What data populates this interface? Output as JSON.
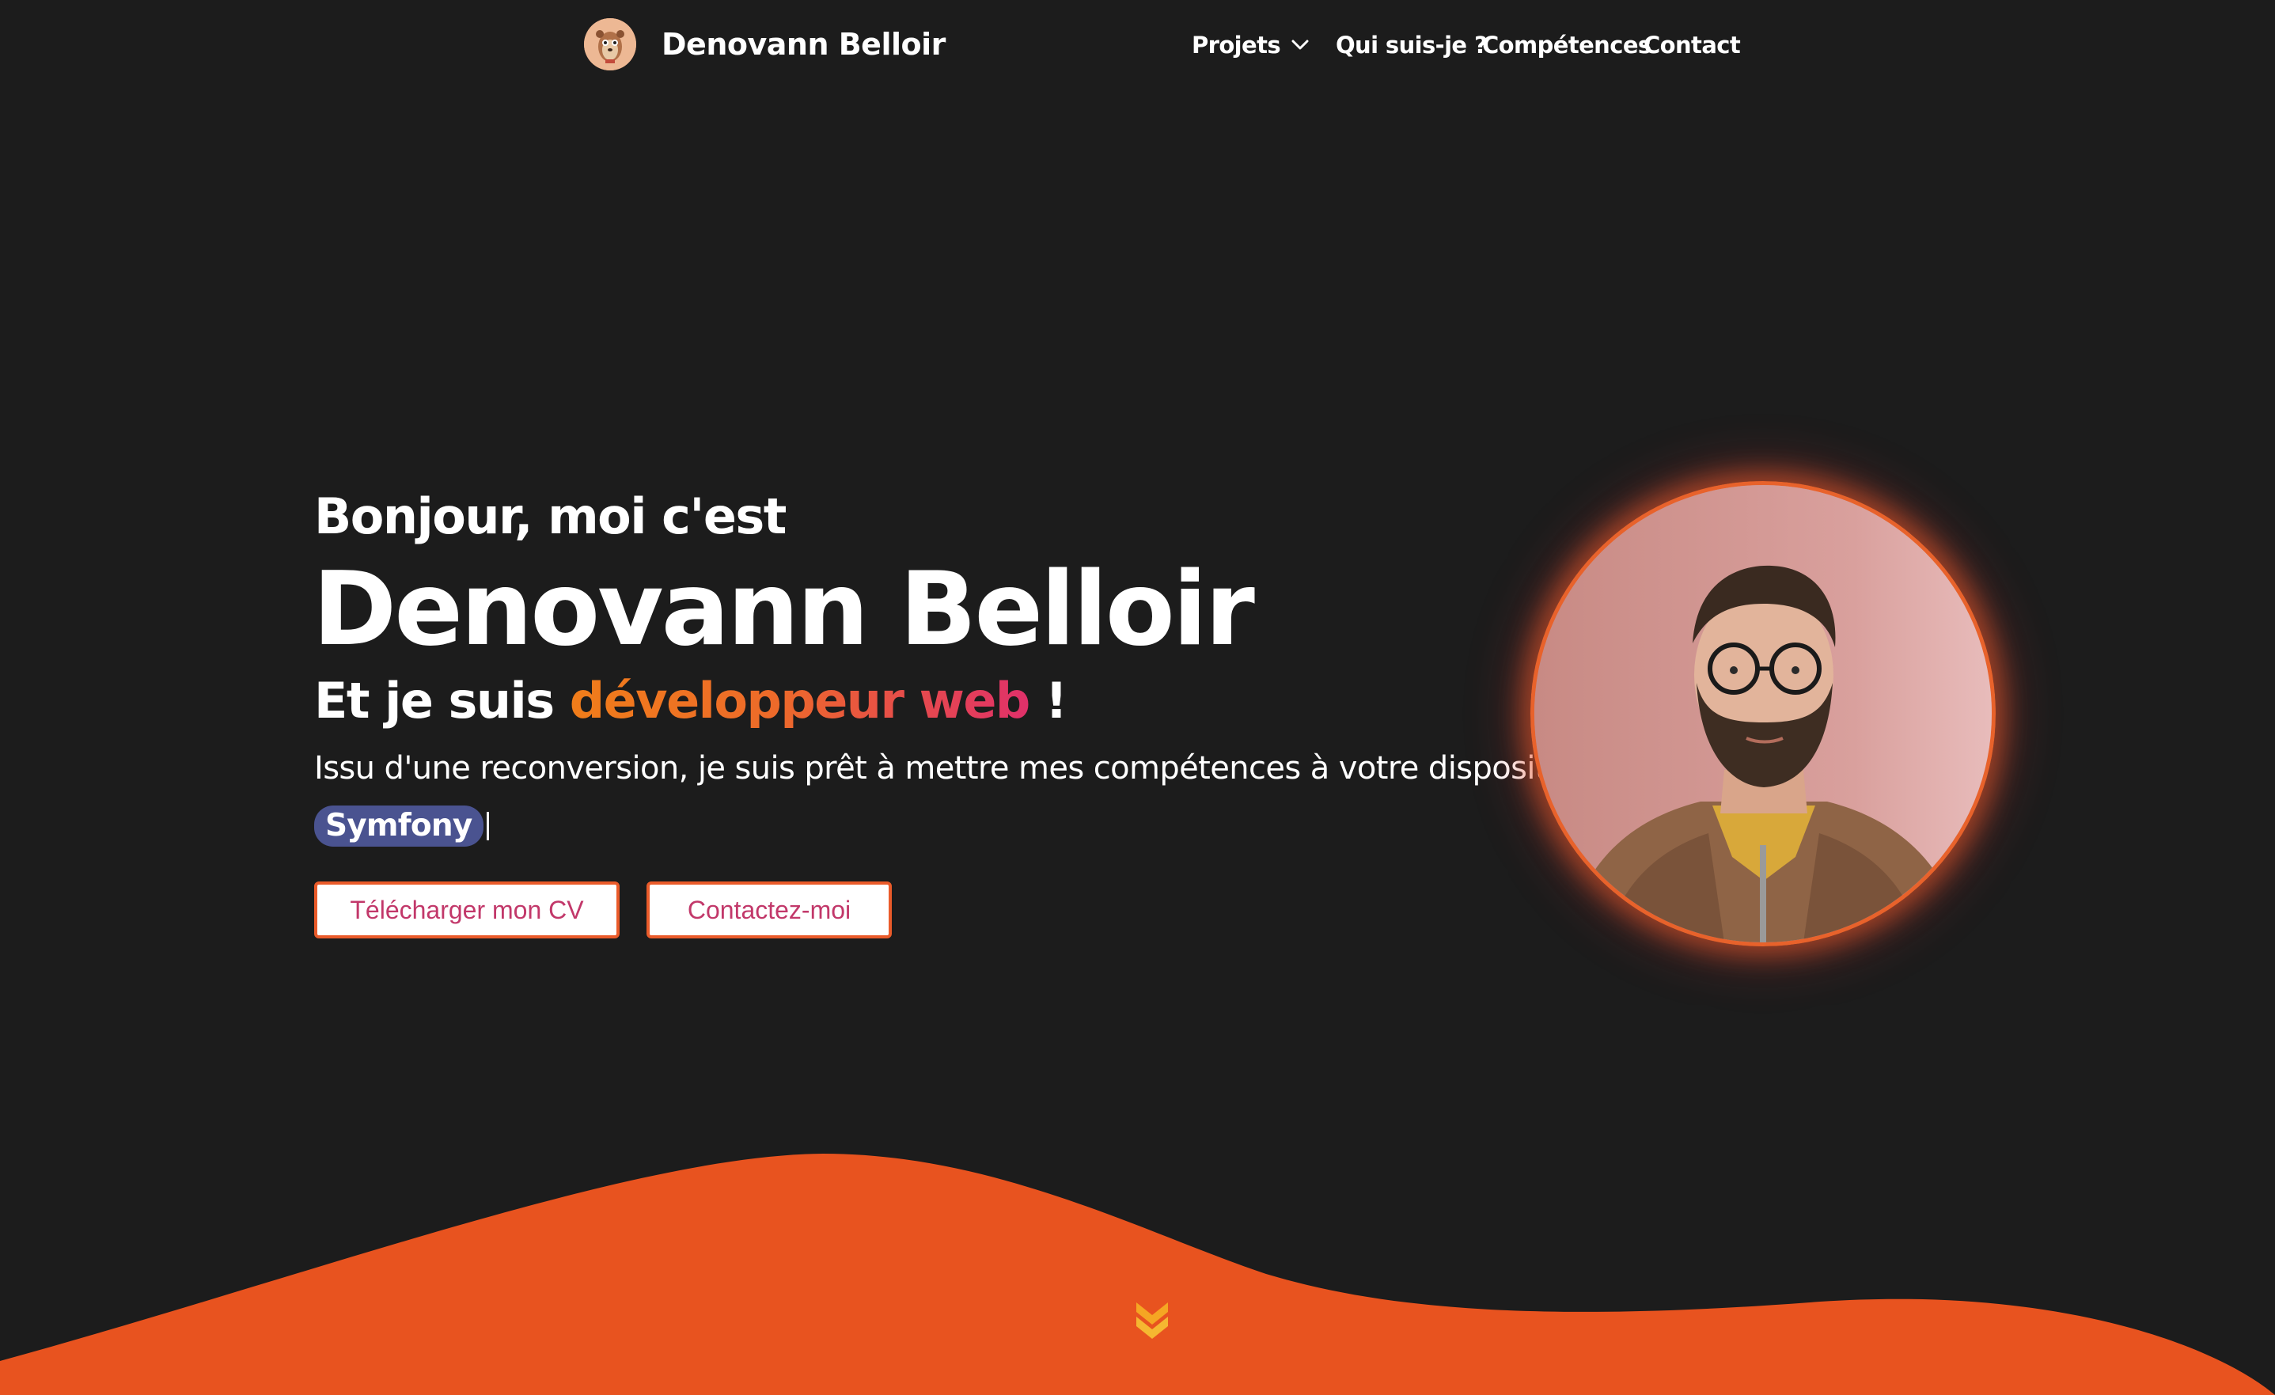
{
  "nav": {
    "brand_name": "Denovann Belloir",
    "brand_logo_icon": "meerkat-avatar-icon",
    "items": [
      {
        "label": "Projets",
        "has_dropdown": true,
        "icon": "chevron-down-icon"
      },
      {
        "label": "Qui suis-je ?"
      },
      {
        "label": "Compétences"
      },
      {
        "label": "Contact"
      }
    ]
  },
  "hero": {
    "greeting": "Bonjour, moi c'est",
    "name": "Denovann Belloir",
    "role_prefix": "Et je suis ",
    "role_accent": "développeur web",
    "role_suffix": " !",
    "description": "Issu d'une reconversion, je suis prêt à mettre mes compétences à votre disposition !",
    "typed_skill": "Symfony",
    "buttons": {
      "cv": "Télécharger mon CV",
      "contact": "Contactez-moi"
    },
    "portrait_alt": "portrait-photo"
  },
  "scroll_icon": "double-chevron-down-icon",
  "colors": {
    "background": "#1c1c1c",
    "accent_orange": "#ea5b2a",
    "gradient_start": "#f07d1a",
    "gradient_end": "#e0306a",
    "badge": "#4a5390",
    "button_text": "#c2386a",
    "scroll_icon": "#f5a623"
  }
}
